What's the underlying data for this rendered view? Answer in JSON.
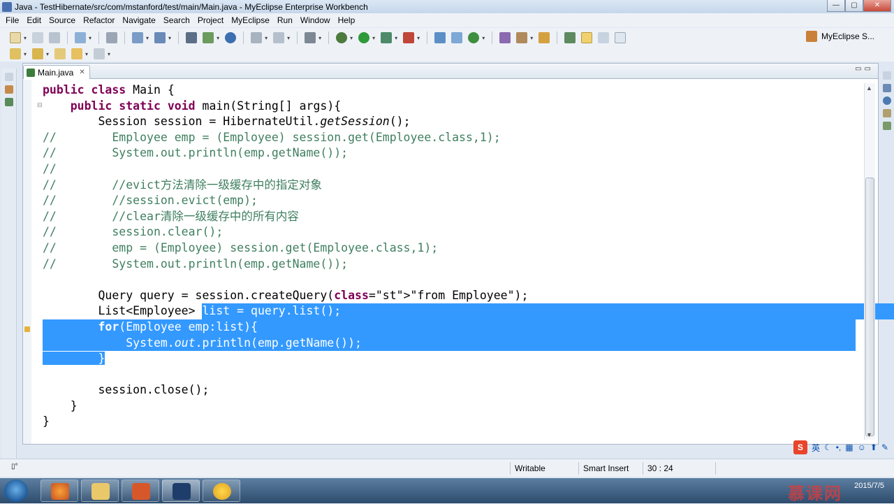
{
  "window": {
    "title": "Java - TestHibernate/src/com/mstanford/test/main/Main.java - MyEclipse Enterprise Workbench",
    "min_label": "—",
    "max_label": "▢",
    "close_label": "✕"
  },
  "menu": [
    "File",
    "Edit",
    "Source",
    "Refactor",
    "Navigate",
    "Search",
    "Project",
    "MyEclipse",
    "Run",
    "Window",
    "Help"
  ],
  "perspective": {
    "label": "MyEclipse S..."
  },
  "editor": {
    "tab_label": "Main.java",
    "tab_close": "✕",
    "controls": "▭▭"
  },
  "code_lines": [
    "public class Main {",
    "    public static void main(String[] args){",
    "        Session session = HibernateUtil.getSession();",
    "//        Employee emp = (Employee) session.get(Employee.class,1);",
    "//        System.out.println(emp.getName());",
    "//",
    "//        //evict方法清除一级缓存中的指定对象",
    "//        //session.evict(emp);",
    "//        //clear清除一级缓存中的所有内容",
    "//        session.clear();",
    "//        emp = (Employee) session.get(Employee.class,1);",
    "//        System.out.println(emp.getName());",
    "",
    "        Query query = session.createQuery(\"from Employee\");",
    "        List<Employee> list = query.list();",
    "        for(Employee emp:list){",
    "            System.out.println(emp.getName());",
    "        }",
    "",
    "        session.close();",
    "    }",
    "}"
  ],
  "statusbar": {
    "writable": "Writable",
    "insert_mode": "Smart Insert",
    "position": "30 : 24"
  },
  "ime": {
    "logo": "S",
    "lang": "英"
  },
  "taskbar": {
    "date": "2015/7/5",
    "time": ""
  },
  "watermark": "慕课网",
  "colors": {
    "keyword": "#7f0055",
    "comment": "#3f7f5f",
    "string": "#2a00ff",
    "selection": "#3399ff"
  }
}
